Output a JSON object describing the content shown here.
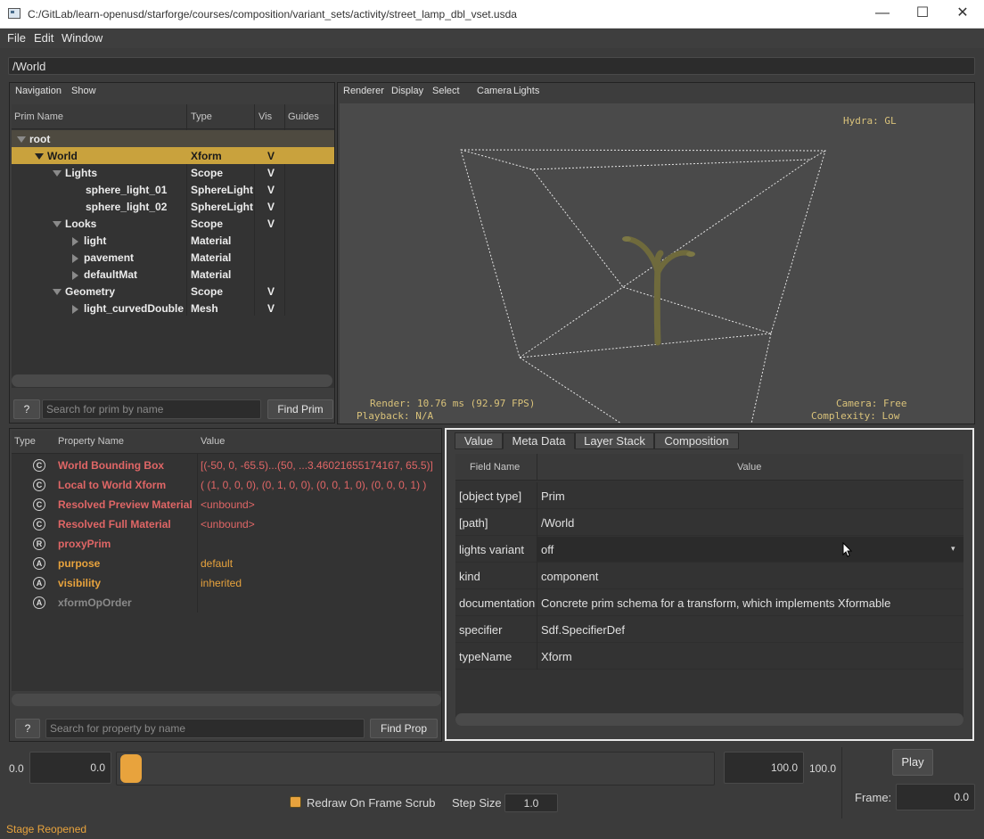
{
  "window": {
    "title": "C:/GitLab/learn-openusd/starforge/courses/composition/variant_sets/activity/street_lamp_dbl_vset.usda",
    "minimize": "—",
    "maximize": "☐",
    "close": "✕"
  },
  "menubar": [
    "File",
    "Edit",
    "Window"
  ],
  "path": "/World",
  "navigation": {
    "menus": [
      "Navigation",
      "Show"
    ],
    "columns": [
      "Prim Name",
      "Type",
      "Vis",
      "Guides"
    ],
    "rows": [
      {
        "name": "root",
        "type": "",
        "vis": "",
        "expanded": true
      },
      {
        "name": "World",
        "type": "Xform",
        "vis": "V",
        "expanded": true
      },
      {
        "name": "Lights",
        "type": "Scope",
        "vis": "V",
        "expanded": true
      },
      {
        "name": "sphere_light_01",
        "type": "SphereLight",
        "vis": "V"
      },
      {
        "name": "sphere_light_02",
        "type": "SphereLight",
        "vis": "V"
      },
      {
        "name": "Looks",
        "type": "Scope",
        "vis": "V",
        "expanded": true
      },
      {
        "name": "light",
        "type": "Material",
        "vis": ""
      },
      {
        "name": "pavement",
        "type": "Material",
        "vis": ""
      },
      {
        "name": "defaultMat",
        "type": "Material",
        "vis": ""
      },
      {
        "name": "Geometry",
        "type": "Scope",
        "vis": "V",
        "expanded": true
      },
      {
        "name": "light_curvedDouble",
        "type": "Mesh",
        "vis": "V"
      }
    ],
    "help_label": "?",
    "search_placeholder": "Search for prim by name",
    "find_label": "Find Prim"
  },
  "viewport": {
    "menus": [
      "Renderer",
      "Display",
      "Select",
      "Camera",
      "Lights"
    ],
    "hud_renderer": "Hydra: GL",
    "hud_render": "Render: 10.76 ms (92.97 FPS)",
    "hud_playback": "Playback: N/A",
    "hud_camera": "Camera: Free",
    "hud_complexity": "Complexity: Low",
    "colors": {
      "background": "#4a4a4a",
      "lamp": "#6f6a3c"
    }
  },
  "properties": {
    "columns": [
      "Type",
      "Property Name",
      "Value"
    ],
    "rows": [
      {
        "badge": "C",
        "name": "World Bounding Box",
        "value": "[(-50, 0, -65.5)...(50, ...3.46021655174167, 65.5)]",
        "style": "red"
      },
      {
        "badge": "C",
        "name": "Local to World Xform",
        "value": "( (1, 0, 0, 0), (0, 1, 0, 0), (0, 0, 1, 0), (0, 0, 0, 1) )",
        "style": "red"
      },
      {
        "badge": "C",
        "name": "Resolved Preview Material",
        "value": "<unbound>",
        "style": "red"
      },
      {
        "badge": "C",
        "name": "Resolved Full Material",
        "value": "<unbound>",
        "style": "red"
      },
      {
        "badge": "R",
        "name": "proxyPrim",
        "value": "",
        "style": "red"
      },
      {
        "badge": "A",
        "name": "purpose",
        "value": "default",
        "style": "orange"
      },
      {
        "badge": "A",
        "name": "visibility",
        "value": "inherited",
        "style": "orange"
      },
      {
        "badge": "A",
        "name": "xformOpOrder",
        "value": "",
        "style": "grey"
      }
    ],
    "help_label": "?",
    "search_placeholder": "Search for property by name",
    "find_label": "Find Prop"
  },
  "metadata": {
    "tabs": [
      "Value",
      "Meta Data",
      "Layer Stack",
      "Composition"
    ],
    "active_tab": "Meta Data",
    "columns": [
      "Field Name",
      "Value"
    ],
    "rows": [
      {
        "field": "[object type]",
        "value": "Prim"
      },
      {
        "field": "[path]",
        "value": "/World"
      },
      {
        "field": "lights variant",
        "value": "off",
        "dropdown": true
      },
      {
        "field": "kind",
        "value": "component"
      },
      {
        "field": "documentation",
        "value": "Concrete prim schema for a transform, which implements Xformable"
      },
      {
        "field": "specifier",
        "value": "Sdf.SpecifierDef"
      },
      {
        "field": "typeName",
        "value": "Xform"
      }
    ]
  },
  "timeline": {
    "start_label": "0.0",
    "start_value": "0.0",
    "end_value": "100.0",
    "end_label": "100.0",
    "play_label": "Play",
    "frame_label": "Frame:",
    "frame_value": "0.0",
    "redraw_label": "Redraw On Frame Scrub",
    "redraw_checked": true,
    "step_label": "Step Size",
    "step_value": "1.0",
    "accent": "#e8a33d"
  },
  "status": "Stage Reopened"
}
